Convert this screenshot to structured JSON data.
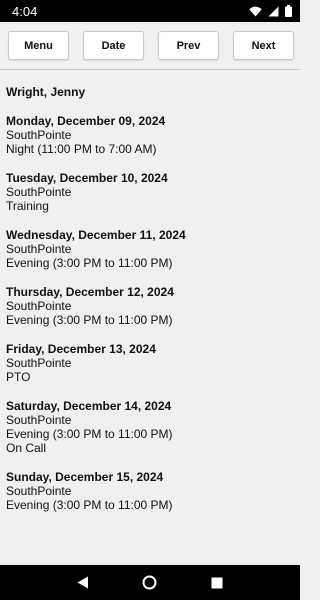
{
  "status_bar": {
    "time": "4:04",
    "icons": [
      "wifi-icon",
      "signal-icon",
      "battery-icon"
    ]
  },
  "toolbar": {
    "menu_label": "Menu",
    "date_label": "Date",
    "prev_label": "Prev",
    "next_label": "Next"
  },
  "schedule": {
    "employee": "Wright, Jenny",
    "days": [
      {
        "date": "Monday, December 09, 2024",
        "lines": [
          "SouthPointe",
          "Night (11:00 PM to 7:00 AM)"
        ]
      },
      {
        "date": "Tuesday, December 10, 2024",
        "lines": [
          "SouthPointe",
          "Training"
        ]
      },
      {
        "date": "Wednesday, December 11, 2024",
        "lines": [
          "SouthPointe",
          "Evening (3:00 PM to 11:00 PM)"
        ]
      },
      {
        "date": "Thursday, December 12, 2024",
        "lines": [
          "SouthPointe",
          "Evening (3:00 PM to 11:00 PM)"
        ]
      },
      {
        "date": "Friday, December 13, 2024",
        "lines": [
          "SouthPointe",
          "PTO"
        ]
      },
      {
        "date": "Saturday, December 14, 2024",
        "lines": [
          "SouthPointe",
          "Evening (3:00 PM to 11:00 PM)",
          "On Call"
        ]
      },
      {
        "date": "Sunday, December 15, 2024",
        "lines": [
          "SouthPointe",
          "Evening (3:00 PM to 11:00 PM)"
        ]
      }
    ]
  },
  "nav_bar": {
    "icons": [
      "back-icon",
      "home-icon",
      "recents-icon"
    ]
  }
}
